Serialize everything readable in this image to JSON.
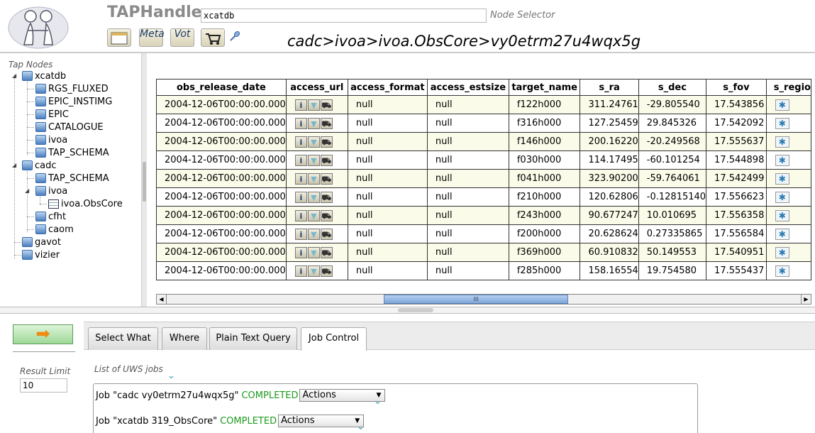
{
  "header": {
    "app_title": "TAPHandle",
    "node_input_value": "xcatdb",
    "node_selector_label": "Node Selector",
    "breadcrumb": "cadc>ivoa>ivoa.ObsCore>vy0etrm27u4wqx5g",
    "meta_button": "Meta",
    "vot_button": "Vot",
    "icons": [
      "logo-image",
      "window-icon",
      "cart-icon",
      "link-icon"
    ]
  },
  "tree": {
    "title": "Tap Nodes",
    "nodes": [
      {
        "label": "xcatdb"
      },
      {
        "label": "RGS_FLUXED"
      },
      {
        "label": "EPIC_INSTIMG"
      },
      {
        "label": "EPIC"
      },
      {
        "label": "CATALOGUE"
      },
      {
        "label": "ivoa"
      },
      {
        "label": "TAP_SCHEMA"
      },
      {
        "label": "cadc"
      },
      {
        "label": "TAP_SCHEMA"
      },
      {
        "label": "ivoa"
      },
      {
        "label": "ivoa.ObsCore"
      },
      {
        "label": "cfht"
      },
      {
        "label": "caom"
      },
      {
        "label": "gavot"
      },
      {
        "label": "vizier"
      }
    ]
  },
  "table": {
    "columns": [
      "obs_release_date",
      "access_url",
      "access_format",
      "access_estsize",
      "target_name",
      "s_ra",
      "s_dec",
      "s_fov",
      "s_regio"
    ],
    "rows": [
      [
        "2004-12-06T00:00:00.000",
        "",
        "null",
        "null",
        "f122h000",
        "311.24761",
        "-29.805540",
        "17.543856",
        ""
      ],
      [
        "2004-12-06T00:00:00.000",
        "",
        "null",
        "null",
        "f316h000",
        "127.25459",
        "29.845326",
        "17.542092",
        ""
      ],
      [
        "2004-12-06T00:00:00.000",
        "",
        "null",
        "null",
        "f146h000",
        "200.16220",
        "-20.249568",
        "17.555637",
        ""
      ],
      [
        "2004-12-06T00:00:00.000",
        "",
        "null",
        "null",
        "f030h000",
        "114.17495",
        "-60.101254",
        "17.544898",
        ""
      ],
      [
        "2004-12-06T00:00:00.000",
        "",
        "null",
        "null",
        "f041h000",
        "323.90200",
        "-59.764061",
        "17.542499",
        ""
      ],
      [
        "2004-12-06T00:00:00.000",
        "",
        "null",
        "null",
        "f210h000",
        "120.62806",
        "-0.12815140",
        "17.556623",
        ""
      ],
      [
        "2004-12-06T00:00:00.000",
        "",
        "null",
        "null",
        "f243h000",
        "90.677247",
        "10.010695",
        "17.556358",
        ""
      ],
      [
        "2004-12-06T00:00:00.000",
        "",
        "null",
        "null",
        "f200h000",
        "20.628624",
        "0.27335865",
        "17.556584",
        ""
      ],
      [
        "2004-12-06T00:00:00.000",
        "",
        "null",
        "null",
        "f369h000",
        "60.910832",
        "50.149553",
        "17.540951",
        ""
      ],
      [
        "2004-12-06T00:00:00.000",
        "",
        "null",
        "null",
        "f285h000",
        "158.16554",
        "19.754580",
        "17.555437",
        ""
      ]
    ],
    "scrollbar_thumb_glyph": "III"
  },
  "query": {
    "result_limit_label": "Result Limit",
    "result_limit_value": "10",
    "tabs": [
      "Select What",
      "Where",
      "Plain Text Query",
      "Job Control"
    ],
    "active_tab": "Job Control"
  },
  "jobs": {
    "label": "List of UWS jobs",
    "items": [
      {
        "name": "Job \"cadc vy0etrm27u4wqx5g\"",
        "status": "COMPLETED",
        "action": "Actions"
      },
      {
        "name": "Job \"xcatdb 319_ObsCore\"",
        "status": "COMPLETED",
        "action": "Actions"
      }
    ]
  },
  "colors": {
    "completed": "#1f9a1f",
    "odd_row": "#fbfbe9",
    "scroll_thumb": "#7ea6da",
    "run_button": "#9fd898",
    "run_arrow": "#f08a10"
  }
}
